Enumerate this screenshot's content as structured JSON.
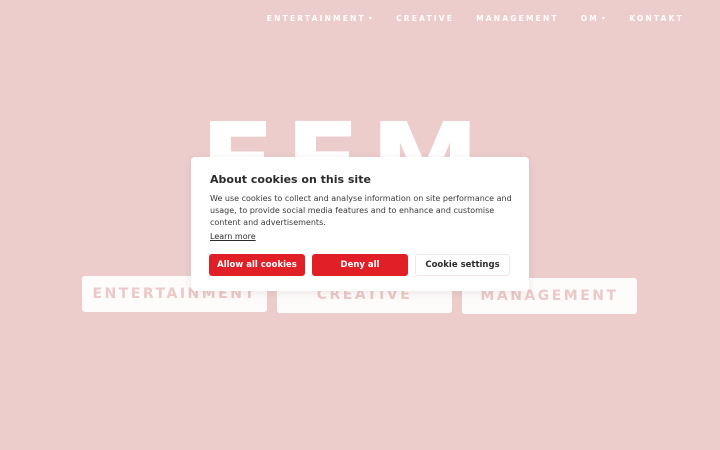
{
  "nav": {
    "items": [
      {
        "label": "ENTERTAINMENT",
        "has_dropdown": true
      },
      {
        "label": "CREATIVE",
        "has_dropdown": false
      },
      {
        "label": "MANAGEMENT",
        "has_dropdown": false
      },
      {
        "label": "OM",
        "has_dropdown": true
      },
      {
        "label": "KONTAKT",
        "has_dropdown": false
      }
    ],
    "chevron": "▾"
  },
  "hero": {
    "big_text": "EFM",
    "cards": [
      "ENTERTAINMENT",
      "CREATIVE",
      "MANAGEMENT"
    ]
  },
  "cookie_dialog": {
    "title": "About cookies on this site",
    "body": "We use cookies to collect and analyse information on site performance and usage, to provide social media features and to enhance and customise content and advertisements.",
    "learn_more": "Learn more",
    "allow_label": "Allow all cookies",
    "deny_label": "Deny all",
    "settings_label": "Cookie settings"
  },
  "colors": {
    "background": "#edcdcc",
    "accent": "#e11f27"
  }
}
